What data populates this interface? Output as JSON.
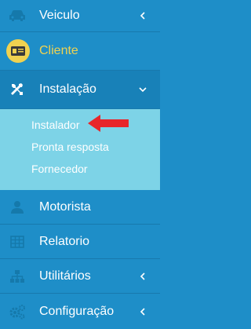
{
  "menu": [
    {
      "label": "Veiculo",
      "icon": "car-icon",
      "chevron": "left"
    },
    {
      "label": "Cliente",
      "icon": "id-card-icon",
      "chevron": "none",
      "highlight": true
    },
    {
      "label": "Instalação",
      "icon": "tools-icon",
      "chevron": "down",
      "active": true
    },
    {
      "label": "Motorista",
      "icon": "user-icon",
      "chevron": "none"
    },
    {
      "label": "Relatorio",
      "icon": "table-icon",
      "chevron": "none"
    },
    {
      "label": "Utilitários",
      "icon": "sitemap-icon",
      "chevron": "left"
    },
    {
      "label": "Configuração",
      "icon": "cogs-icon",
      "chevron": "left"
    }
  ],
  "submenu": [
    "Instalador",
    "Pronta resposta",
    "Fornecedor"
  ],
  "colors": {
    "sidebar_bg": "#1e8ec8",
    "submenu_bg": "#7dd3e7",
    "highlight": "#f0d250",
    "arrow": "#e8262a"
  }
}
